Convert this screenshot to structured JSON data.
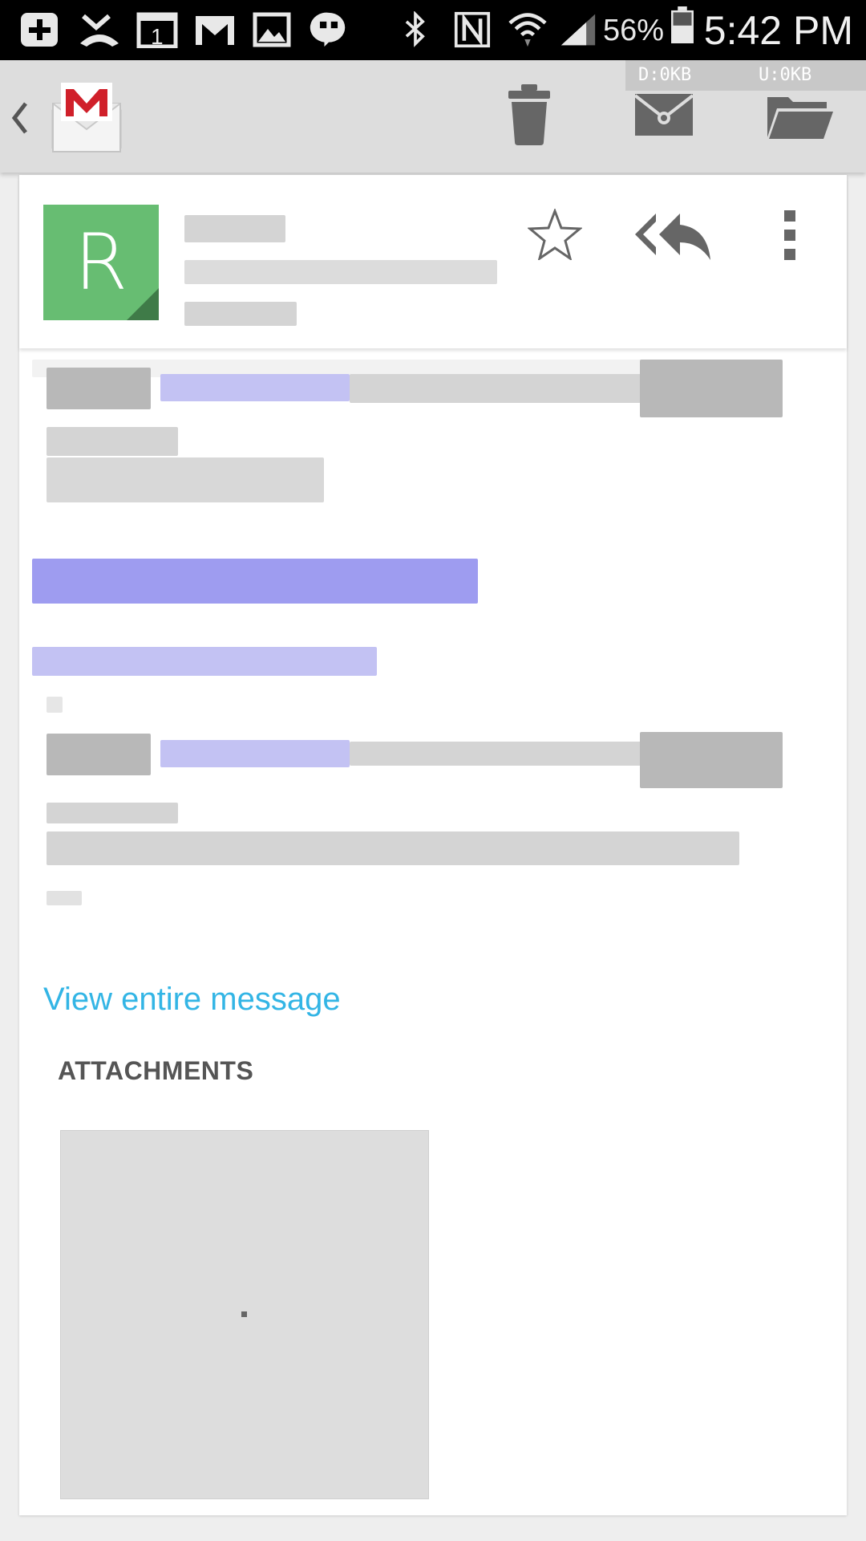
{
  "status_bar": {
    "icons": [
      "plus-icon",
      "missed-call-icon",
      "calendar-icon",
      "gmail-icon",
      "image-icon",
      "hangouts-icon",
      "bluetooth-icon",
      "nfc-icon",
      "wifi-icon",
      "signal-icon",
      "battery-icon"
    ],
    "calendar_day": "1",
    "battery_percent": "56%",
    "time": "5:42 PM"
  },
  "action_bar": {
    "traffic_download": "D:0KB",
    "traffic_upload": "U:0KB",
    "icons": [
      "back-chevron-icon",
      "gmail-logo-icon",
      "trash-icon",
      "unread-envelope-icon",
      "folder-icon"
    ]
  },
  "message_header": {
    "avatar_letter": "R",
    "avatar_color": "#67bd72",
    "icons": [
      "star-icon",
      "reply-all-icon",
      "overflow-menu-icon"
    ]
  },
  "message_body": {
    "view_entire_label": "View entire message",
    "link_color": "#33b5e5"
  },
  "attachments": {
    "title": "ATTACHMENTS"
  }
}
